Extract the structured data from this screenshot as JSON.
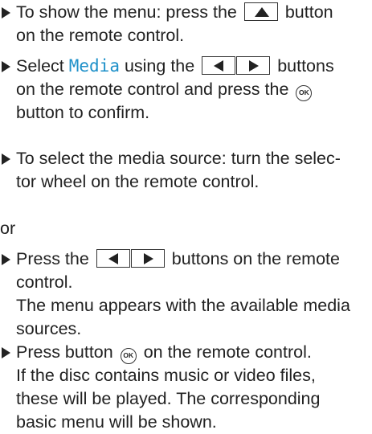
{
  "instructions": {
    "step1": {
      "a": "To show the menu: press the",
      "b": "button",
      "c": "on the remote control.",
      "key_icon": "up-arrow-icon"
    },
    "step2": {
      "a": "Select",
      "media": "Media",
      "b": "using the",
      "c": "buttons",
      "d": "on the remote control and press the",
      "e": "button to confirm.",
      "ok_label": "OK",
      "key_icons": [
        "left-arrow-icon",
        "right-arrow-icon"
      ]
    },
    "step3": {
      "a": "To select the media source: turn the selec-",
      "b": "tor wheel on the remote control."
    },
    "or": "or",
    "step4": {
      "a": "Press the",
      "b": "buttons on the remote",
      "c": "control.",
      "d": "The menu appears with the available media",
      "e": "sources."
    },
    "step5": {
      "a": "Press button",
      "ok_label": "OK",
      "b": "on the remote control.",
      "c": "If the disc contains music or video files,",
      "d": "these will be played. The corresponding",
      "e": "basic menu will be shown."
    }
  },
  "colors": {
    "text": "#222222",
    "accent": "#1e90c9"
  }
}
